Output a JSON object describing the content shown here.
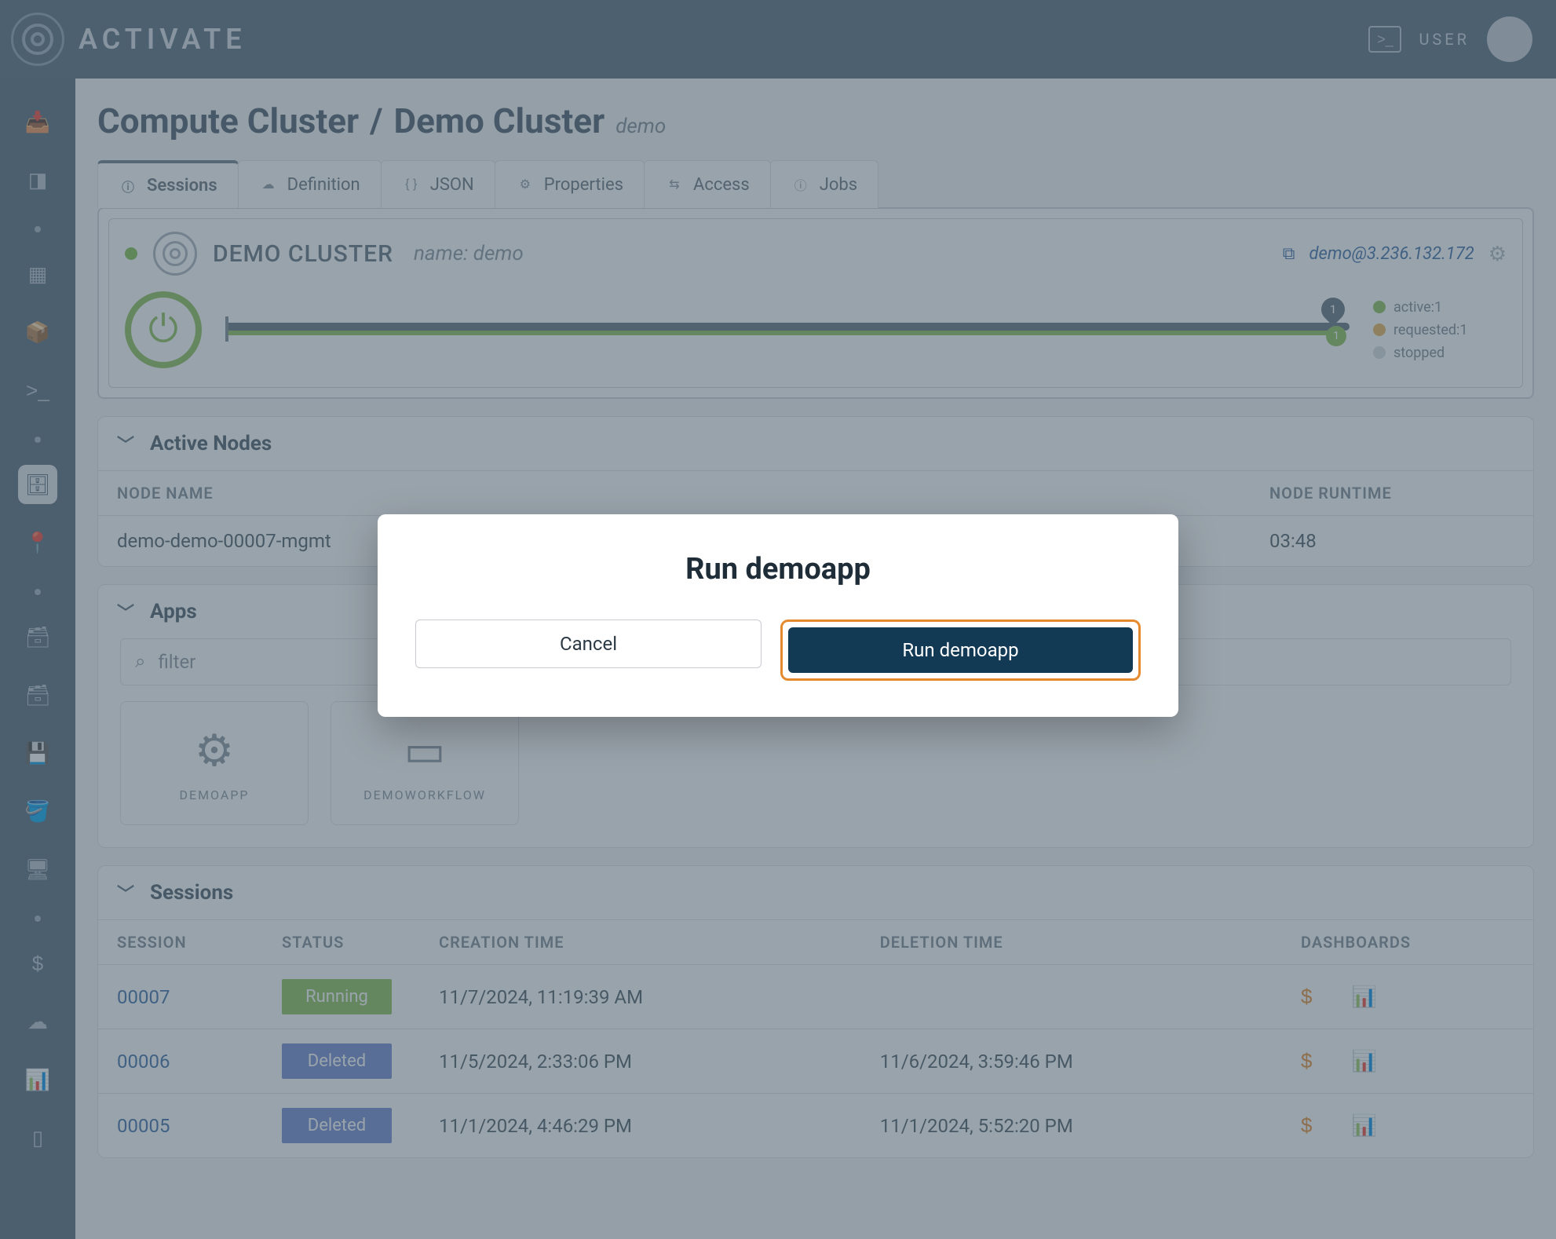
{
  "brand": {
    "name": "ACTIVATE"
  },
  "topbar": {
    "user_label": "USER"
  },
  "breadcrumb": {
    "segment_a": "Compute Cluster",
    "segment_b": "Demo Cluster",
    "sub": "demo"
  },
  "tabs": [
    {
      "label": "Sessions",
      "icon": "info"
    },
    {
      "label": "Definition",
      "icon": "cloud"
    },
    {
      "label": "JSON",
      "icon": "braces"
    },
    {
      "label": "Properties",
      "icon": "gear"
    },
    {
      "label": "Access",
      "icon": "share"
    },
    {
      "label": "Jobs",
      "icon": "info"
    }
  ],
  "cluster": {
    "title": "DEMO CLUSTER",
    "subtitle": "name: demo",
    "ssh_text": "demo@3.236.132.172",
    "balloon": "1",
    "badge": "1",
    "legend": {
      "active": {
        "label": "active:1",
        "color": "#8cc15a"
      },
      "requested": {
        "label": "requested:1",
        "color": "#e9b45a"
      },
      "stopped": {
        "label": "stopped",
        "color": "#d7dcdf"
      }
    }
  },
  "nodes": {
    "heading": "Active Nodes",
    "cols": {
      "name": "NODE NAME",
      "runtime": "NODE RUNTIME"
    },
    "rows": [
      {
        "name": "demo-demo-00007-mgmt",
        "runtime": "03:48"
      }
    ]
  },
  "apps": {
    "heading": "Apps",
    "filter_placeholder": "filter",
    "items": [
      {
        "label": "DEMOAPP",
        "icon": "gear"
      },
      {
        "label": "DEMOWORKFLOW",
        "icon": "console"
      }
    ]
  },
  "sessions": {
    "heading": "Sessions",
    "cols": {
      "session": "SESSION",
      "status": "STATUS",
      "created": "CREATION TIME",
      "deleted": "DELETION TIME",
      "dash": "DASHBOARDS"
    },
    "rows": [
      {
        "id": "00007",
        "status": "Running",
        "status_kind": "run",
        "created": "11/7/2024, 11:19:39 AM",
        "deleted": ""
      },
      {
        "id": "00006",
        "status": "Deleted",
        "status_kind": "del",
        "created": "11/5/2024, 2:33:06 PM",
        "deleted": "11/6/2024, 3:59:46 PM"
      },
      {
        "id": "00005",
        "status": "Deleted",
        "status_kind": "del",
        "created": "11/1/2024, 4:46:29 PM",
        "deleted": "11/1/2024, 5:52:20 PM"
      }
    ]
  },
  "modal": {
    "title": "Run demoapp",
    "cancel": "Cancel",
    "confirm": "Run demoapp"
  }
}
